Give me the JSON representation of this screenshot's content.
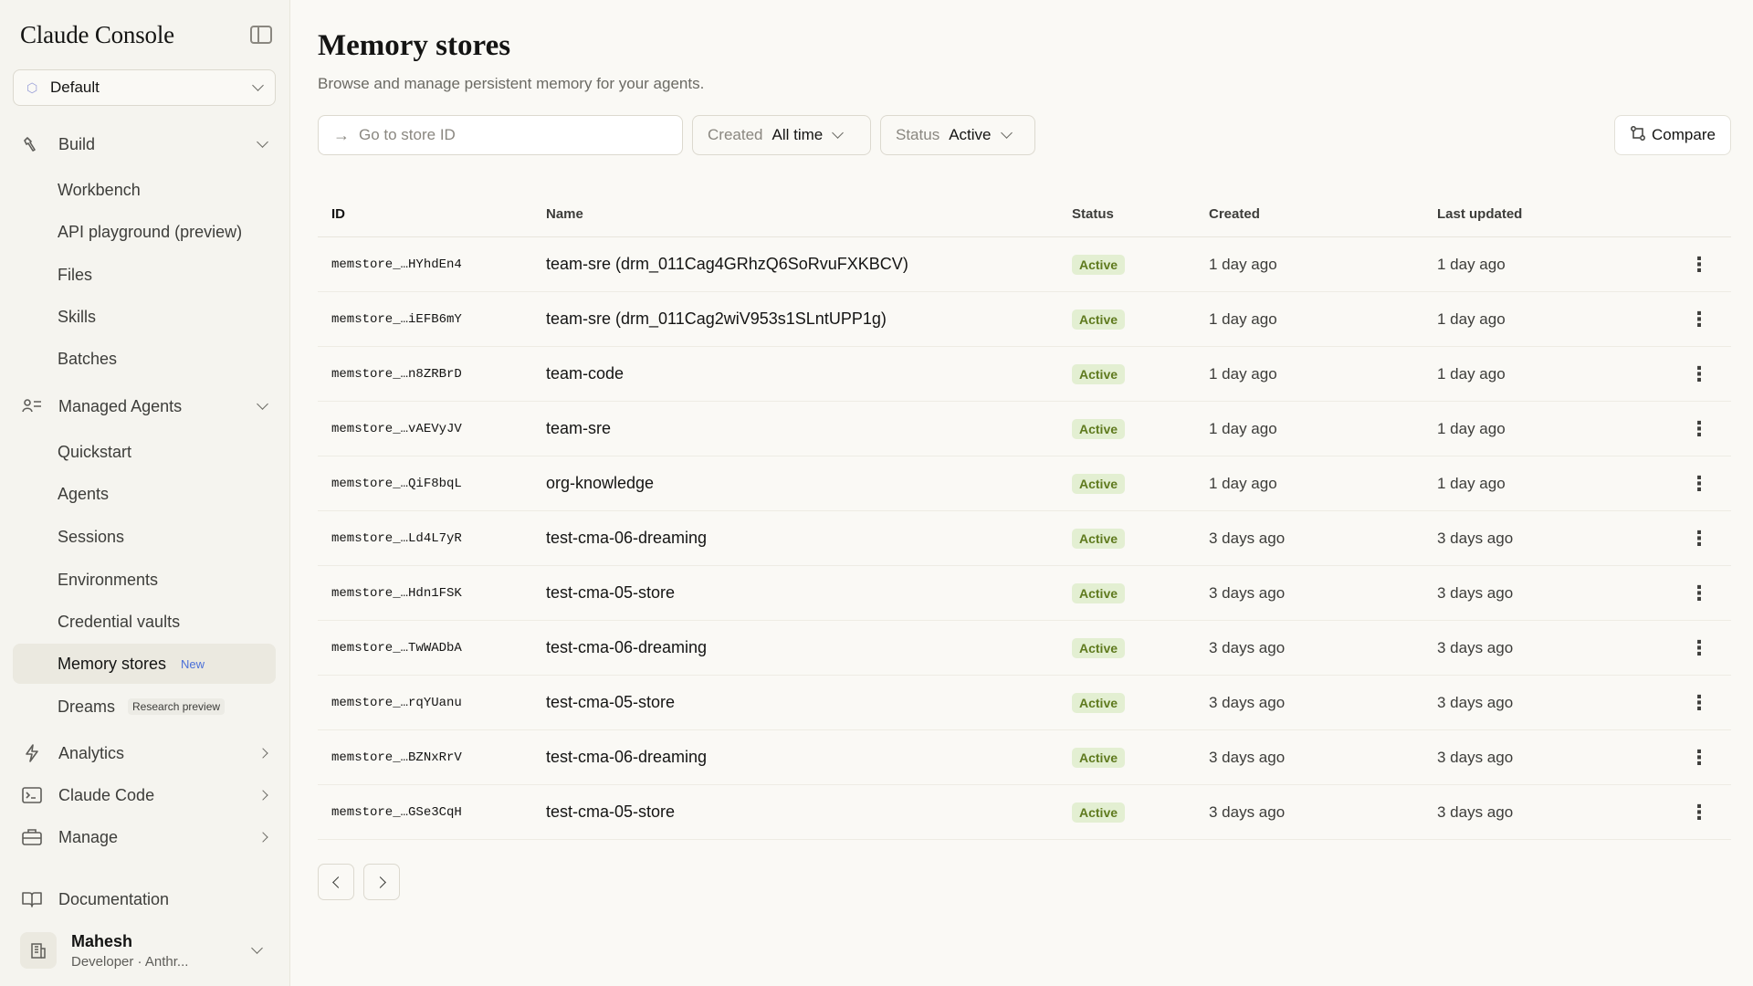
{
  "brand": "Claude Console",
  "workspace": {
    "label": "Default"
  },
  "sidebar": {
    "build": {
      "label": "Build",
      "items": [
        "Workbench",
        "API playground (preview)",
        "Files",
        "Skills",
        "Batches"
      ]
    },
    "managed_agents": {
      "label": "Managed Agents",
      "items": [
        "Quickstart",
        "Agents",
        "Sessions",
        "Environments",
        "Credential vaults"
      ],
      "memory_stores": {
        "label": "Memory stores",
        "badge": "New"
      },
      "dreams": {
        "label": "Dreams",
        "badge": "Research preview"
      }
    },
    "analytics": "Analytics",
    "claude_code": "Claude Code",
    "manage": "Manage",
    "documentation": "Documentation",
    "user": {
      "name": "Mahesh",
      "sub": "Developer · Anthr..."
    }
  },
  "page": {
    "title": "Memory stores",
    "subtitle": "Browse and manage persistent memory for your agents."
  },
  "search": {
    "placeholder": "Go to store ID"
  },
  "filters": {
    "created": {
      "key": "Created",
      "value": "All time"
    },
    "status": {
      "key": "Status",
      "value": "Active"
    }
  },
  "compare_label": "Compare",
  "table": {
    "headers": {
      "id": "ID",
      "name": "Name",
      "status": "Status",
      "created": "Created",
      "updated": "Last updated"
    },
    "rows": [
      {
        "id": "memstore_…HYhdEn4",
        "name": "team-sre (drm_011Cag4GRhzQ6SoRvuFXKBCV)",
        "status": "Active",
        "created": "1 day ago",
        "updated": "1 day ago"
      },
      {
        "id": "memstore_…iEFB6mY",
        "name": "team-sre (drm_011Cag2wiV953s1SLntUPP1g)",
        "status": "Active",
        "created": "1 day ago",
        "updated": "1 day ago"
      },
      {
        "id": "memstore_…n8ZRBrD",
        "name": "team-code",
        "status": "Active",
        "created": "1 day ago",
        "updated": "1 day ago"
      },
      {
        "id": "memstore_…vAEVyJV",
        "name": "team-sre",
        "status": "Active",
        "created": "1 day ago",
        "updated": "1 day ago"
      },
      {
        "id": "memstore_…QiF8bqL",
        "name": "org-knowledge",
        "status": "Active",
        "created": "1 day ago",
        "updated": "1 day ago"
      },
      {
        "id": "memstore_…Ld4L7yR",
        "name": "test-cma-06-dreaming",
        "status": "Active",
        "created": "3 days ago",
        "updated": "3 days ago"
      },
      {
        "id": "memstore_…Hdn1FSK",
        "name": "test-cma-05-store",
        "status": "Active",
        "created": "3 days ago",
        "updated": "3 days ago"
      },
      {
        "id": "memstore_…TwWADbA",
        "name": "test-cma-06-dreaming",
        "status": "Active",
        "created": "3 days ago",
        "updated": "3 days ago"
      },
      {
        "id": "memstore_…rqYUanu",
        "name": "test-cma-05-store",
        "status": "Active",
        "created": "3 days ago",
        "updated": "3 days ago"
      },
      {
        "id": "memstore_…BZNxRrV",
        "name": "test-cma-06-dreaming",
        "status": "Active",
        "created": "3 days ago",
        "updated": "3 days ago"
      },
      {
        "id": "memstore_…GSe3CqH",
        "name": "test-cma-05-store",
        "status": "Active",
        "created": "3 days ago",
        "updated": "3 days ago"
      }
    ]
  },
  "colors": {
    "accent_new": "#4a6fd8",
    "status_bg": "#e3efd2",
    "status_fg": "#5f7a1e"
  }
}
